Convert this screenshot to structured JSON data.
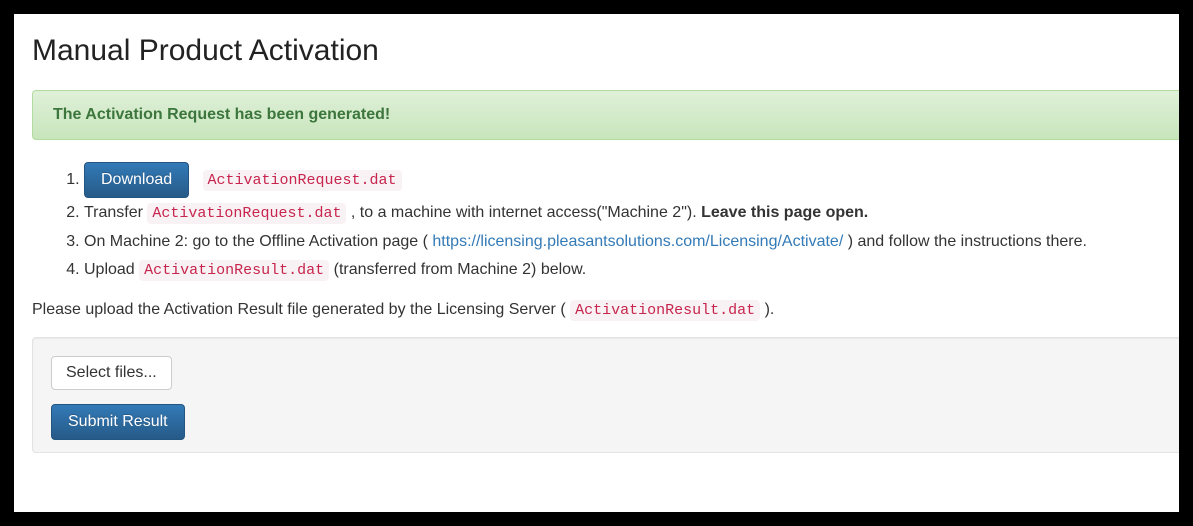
{
  "title": "Manual Product Activation",
  "alert": "The Activation Request has been generated!",
  "files": {
    "request": "ActivationRequest.dat",
    "result": "ActivationResult.dat"
  },
  "steps": {
    "download_button": "Download",
    "step2_prefix": "Transfer ",
    "step2_mid": ", to a machine with internet access(\"Machine 2\"). ",
    "step2_bold": "Leave this page open.",
    "step3_prefix": "On Machine 2: go to the Offline Activation page (",
    "step3_link": "https://licensing.pleasantsolutions.com/Licensing/Activate/",
    "step3_suffix": ") and follow the instructions there.",
    "step4_prefix": "Upload ",
    "step4_suffix": " (transferred from Machine 2) below."
  },
  "upload": {
    "intro_prefix": "Please upload the Activation Result file generated by the Licensing Server ( ",
    "intro_suffix": " ).",
    "select_label": "Select files...",
    "submit_label": "Submit Result"
  }
}
